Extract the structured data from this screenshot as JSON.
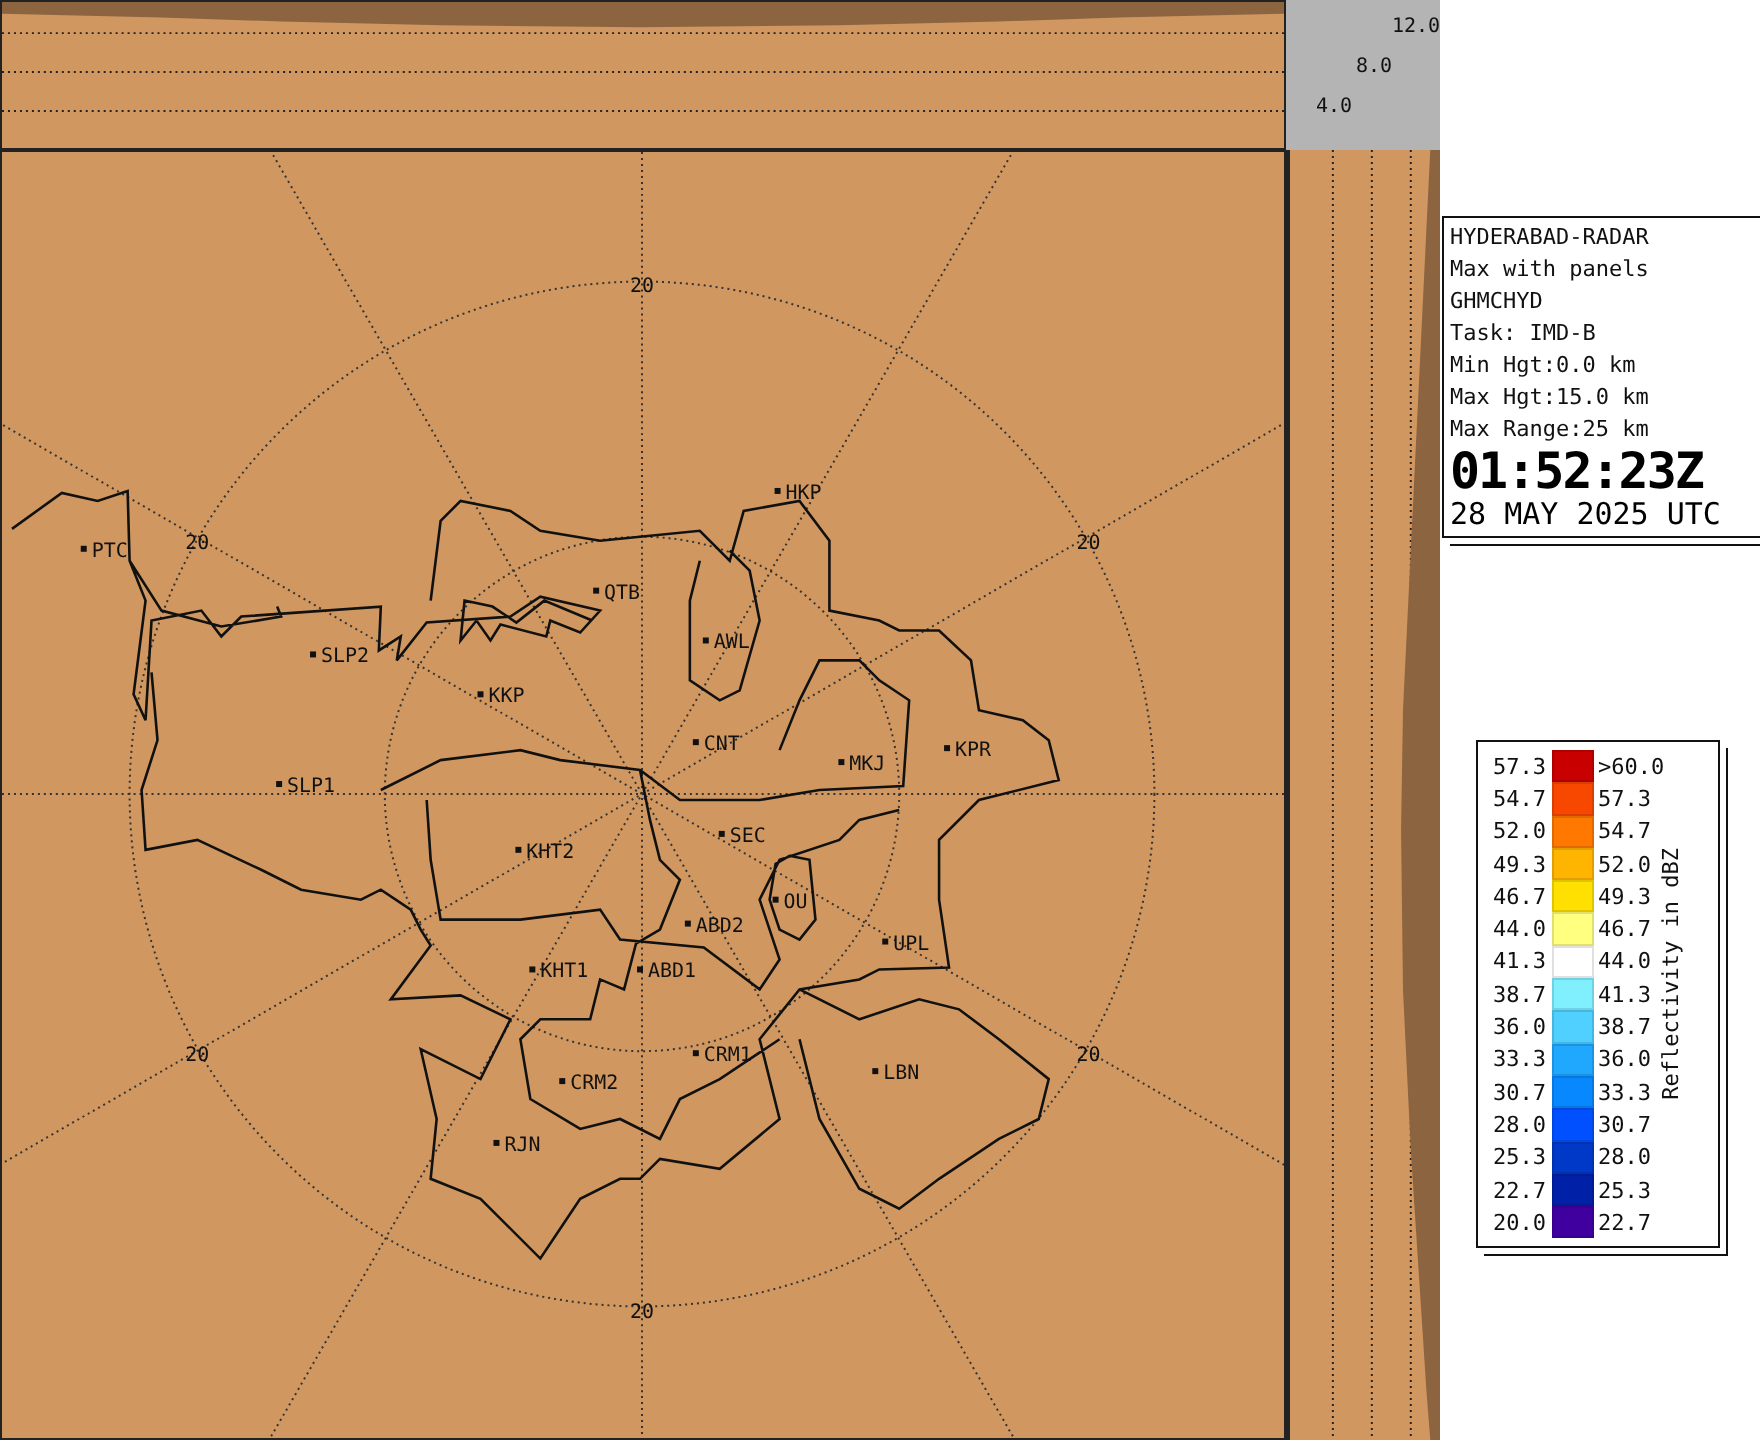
{
  "top_panel": {
    "height_labels": [
      "12.0",
      "8.0",
      "4.0"
    ]
  },
  "map": {
    "ring_labels": [
      "20",
      "20",
      "20",
      "20",
      "20",
      "20"
    ],
    "stations": [
      {
        "name": "PTC"
      },
      {
        "name": "SLP2"
      },
      {
        "name": "SLP1"
      },
      {
        "name": "KKP"
      },
      {
        "name": "QTB"
      },
      {
        "name": "HKP"
      },
      {
        "name": "AWL"
      },
      {
        "name": "CNT"
      },
      {
        "name": "MKJ"
      },
      {
        "name": "KPR"
      },
      {
        "name": "SEC"
      },
      {
        "name": "OU"
      },
      {
        "name": "ABD2"
      },
      {
        "name": "KHT2"
      },
      {
        "name": "KHT1"
      },
      {
        "name": "ABD1"
      },
      {
        "name": "CRM1"
      },
      {
        "name": "UPL"
      },
      {
        "name": "LBN"
      },
      {
        "name": "CRM2"
      },
      {
        "name": "RJN"
      }
    ]
  },
  "info": {
    "lines": [
      "HYDERABAD-RADAR",
      "Max with panels",
      "GHMCHYD",
      "Task: IMD-B",
      "Min Hgt:0.0 km",
      "Max Hgt:15.0 km",
      "Max Range:25 km"
    ],
    "time": "01:52:23Z",
    "date": "28 MAY 2025 UTC"
  },
  "legend": {
    "title": "Reflectivity in dBZ",
    "rows": [
      {
        "low": "57.3",
        "high": ">60.0",
        "color": "#c80000"
      },
      {
        "low": "54.7",
        "high": "57.3",
        "color": "#f84800"
      },
      {
        "low": "52.0",
        "high": "54.7",
        "color": "#ff7800"
      },
      {
        "low": "49.3",
        "high": "52.0",
        "color": "#ffb400"
      },
      {
        "low": "46.7",
        "high": "49.3",
        "color": "#ffe000"
      },
      {
        "low": "44.0",
        "high": "46.7",
        "color": "#ffff80"
      },
      {
        "low": "41.3",
        "high": "44.0",
        "color": "#ffffff"
      },
      {
        "low": "38.7",
        "high": "41.3",
        "color": "#80f0ff"
      },
      {
        "low": "36.0",
        "high": "38.7",
        "color": "#50d0ff"
      },
      {
        "low": "33.3",
        "high": "36.0",
        "color": "#20a8ff"
      },
      {
        "low": "30.7",
        "high": "33.3",
        "color": "#0888ff"
      },
      {
        "low": "28.0",
        "high": "30.7",
        "color": "#0050ff"
      },
      {
        "low": "25.3",
        "high": "28.0",
        "color": "#0038c8"
      },
      {
        "low": "22.7",
        "high": "25.3",
        "color": "#0020a8"
      },
      {
        "low": "20.0",
        "high": "22.7",
        "color": "#4000a0"
      }
    ]
  }
}
